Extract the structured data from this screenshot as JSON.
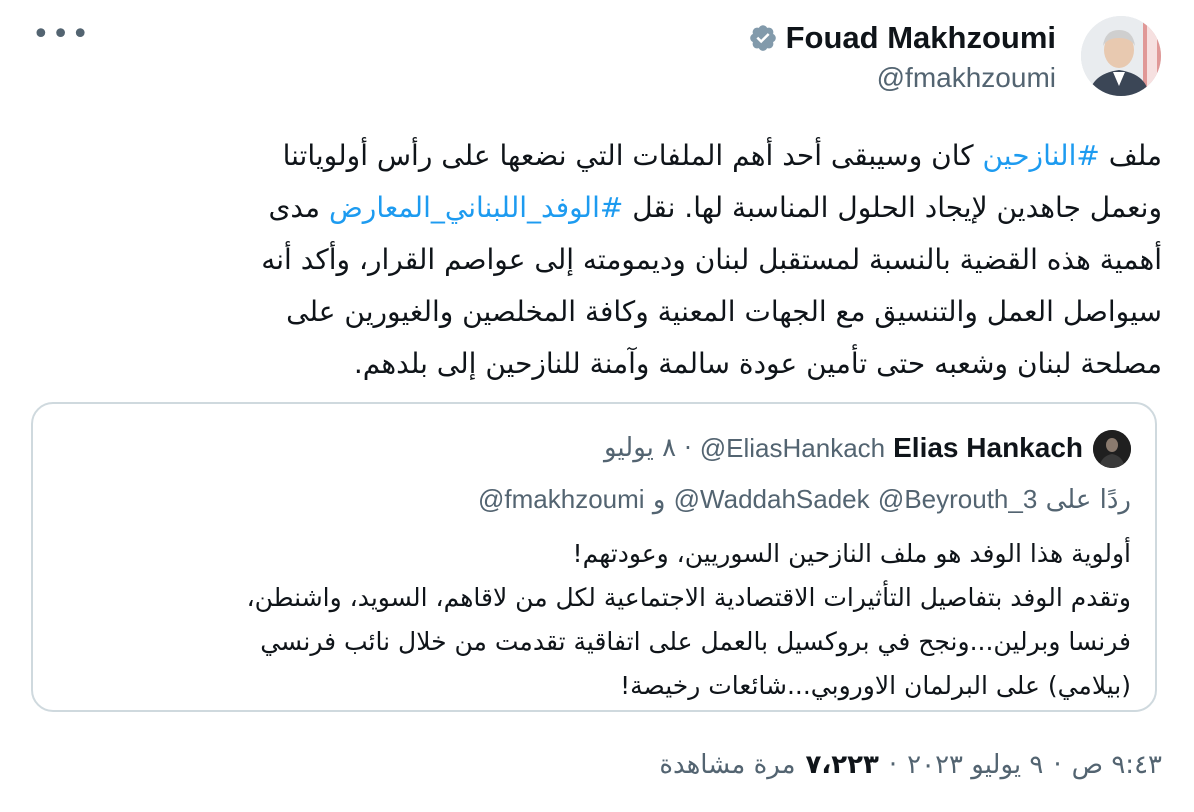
{
  "author": {
    "name": "Fouad Makhzoumi",
    "handle": "@fmakhzoumi"
  },
  "tweet": {
    "lines": [
      [
        {
          "t": "ملف ",
          "h": false
        },
        {
          "t": "#النازحين",
          "h": true
        },
        {
          "t": " كان وسيبقى أحد أهم الملفات التي نضعها على رأس أولوياتنا",
          "h": false
        }
      ],
      [
        {
          "t": "ونعمل جاهدين لإيجاد الحلول المناسبة لها. نقل ",
          "h": false
        },
        {
          "t": "#الوفد_اللبناني_المعارض",
          "h": true
        },
        {
          "t": " مدى",
          "h": false
        }
      ],
      [
        {
          "t": "أهمية هذه القضية بالنسبة لمستقبل لبنان وديمومته إلى عواصم القرار،  وأكد أنه",
          "h": false
        }
      ],
      [
        {
          "t": "سيواصل العمل والتنسيق مع الجهات المعنية وكافة المخلصين والغيورين على",
          "h": false
        }
      ],
      [
        {
          "t": "مصلحة لبنان وشعبه حتى تأمين عودة سالمة وآمنة للنازحين إلى بلدهم.",
          "h": false
        }
      ]
    ]
  },
  "quote": {
    "name": "Elias Hankach",
    "handle": "@EliasHankach",
    "separator": "·",
    "date": "٨ يوليو",
    "reply_prefix": "ردًا على",
    "reply_mentions": [
      "@Beyrouth_3",
      "@WaddahSadek"
    ],
    "reply_and": "و",
    "reply_last": "@fmakhzoumi",
    "lines": [
      "أولوية هذا الوفد هو ملف النازحين السوريين، وعودتهم!",
      "وتقدم الوفد بتفاصيل التأثيرات الاقتصادية الاجتماعية لكل من لاقاهم، السويد، واشنطن،",
      "فرنسا وبرلين...ونجح في بروكسيل بالعمل على اتفاقية تقدمت من خلال نائب فرنسي",
      "(بيلامي) على البرلمان الاوروبي...شائعات رخيصة!"
    ]
  },
  "meta": {
    "time": "٩:٤٣ ص",
    "date": "٩ يوليو ٢٠٢٣",
    "separator": "·",
    "views_count": "٧،٢٢٣",
    "views_label": "مرة مشاهدة"
  },
  "icons": {
    "more": "more-options-icon",
    "verified": "verified-badge-icon"
  },
  "colors": {
    "link": "#1d9bf0",
    "secondary_text": "#536471",
    "border": "#cfd9de",
    "verified_badge": "#829aab"
  }
}
